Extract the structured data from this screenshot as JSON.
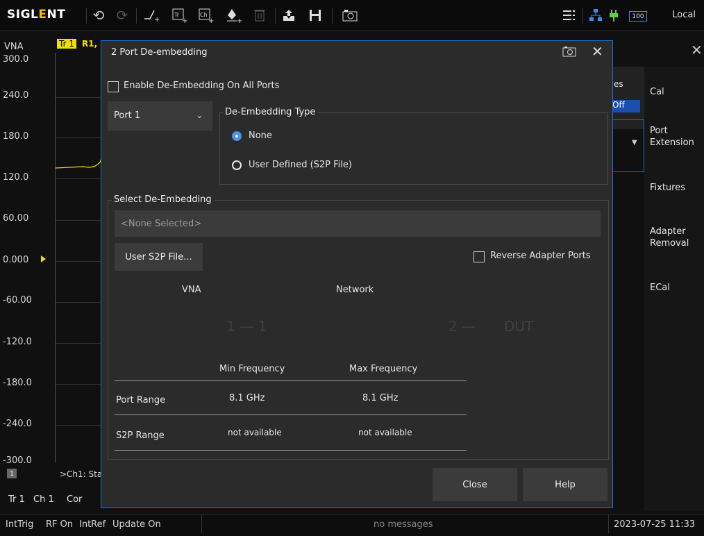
{
  "toolbar": {
    "logo_main": "SIGL",
    "logo_accent": "E",
    "logo_end": "NT",
    "battery_label": "100",
    "remote_status": "Local",
    "icons": [
      "undo-icon",
      "redo-icon",
      "add-marker-icon",
      "add-trace-icon",
      "add-channel-icon",
      "marker-icon",
      "delete-icon",
      "recall-icon",
      "save-icon",
      "screenshot-icon",
      "menu-icon",
      "network-icon",
      "power-icon",
      "battery-icon"
    ]
  },
  "chart": {
    "channel_label": "VNA",
    "trace_tab": "Tr 1",
    "trace_meas": "R1,",
    "y_ticks": [
      "300.0",
      "240.0",
      "180.0",
      "120.0",
      "60.00",
      "0.000",
      "-60.00",
      "-120.0",
      "-180.0",
      "-240.0",
      "-300.0"
    ],
    "channel_number": "1",
    "channel_status": ">Ch1: Sta",
    "footer_tr": "Tr 1",
    "footer_ch": "Ch 1",
    "footer_cor": "Cor"
  },
  "softkeys": {
    "partial_es": "es",
    "partial_off": "Off",
    "cal": "Cal",
    "port_extension_1": "Port",
    "port_extension_2": "Extension",
    "fixtures": "Fixtures",
    "adapter_removal_1": "Adapter",
    "adapter_removal_2": "Removal",
    "ecal": "ECal"
  },
  "dialog": {
    "title": "2 Port De-embedding",
    "enable_all_label": "Enable De-Embedding On All Ports",
    "port_select_value": "Port 1",
    "type_group_title": "De-Embedding Type",
    "radio_none_label": "None",
    "radio_user_label": "User Defined (S2P File)",
    "select_group_title": "Select De-Embedding",
    "file_field_placeholder": "<None Selected>",
    "user_s2p_button": "User S2P File...",
    "reverse_ports_label": "Reverse Adapter Ports",
    "diagram_vna": "VNA",
    "diagram_network": "Network",
    "diagram_port1": "1",
    "diagram_dash1": "—",
    "diagram_port1b": "1",
    "diagram_port2": "2",
    "diagram_dash2": "—",
    "diagram_dut": "DUT",
    "table_headers": [
      "Min Frequency",
      "Max Frequency"
    ],
    "table_rows": [
      {
        "label": "Port Range",
        "min": "8.1 GHz",
        "max": "8.1 GHz"
      },
      {
        "label": "S2P Range",
        "min": "not available",
        "max": "not available"
      }
    ],
    "close_button": "Close",
    "help_button": "Help"
  },
  "statusbar": {
    "trigger": "IntTrig",
    "rf": "RF On",
    "ref": "IntRef",
    "update": "Update On",
    "messages": "no messages",
    "datetime": "2023-07-25 11:33"
  }
}
